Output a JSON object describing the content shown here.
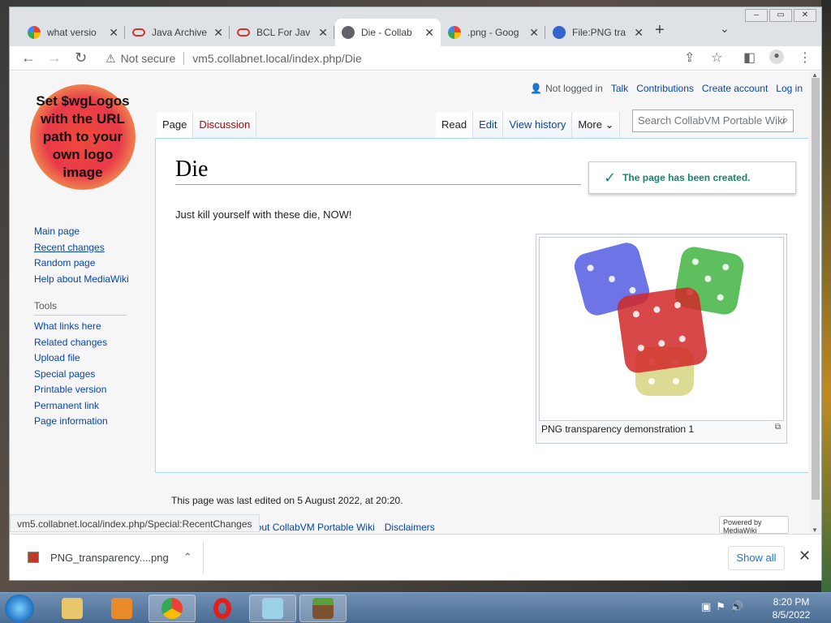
{
  "browser": {
    "tabs": [
      {
        "title": "what versio",
        "icon": "google-icon"
      },
      {
        "title": "Java Archive",
        "icon": "oracle-icon"
      },
      {
        "title": "BCL For Jav",
        "icon": "oracle-icon"
      },
      {
        "title": "Die - Collab",
        "icon": "globe-icon",
        "active": true
      },
      {
        "title": ".png - Goog",
        "icon": "google-icon"
      },
      {
        "title": "File:PNG tra",
        "icon": "wiki-icon"
      }
    ],
    "not_secure": "Not secure",
    "url": "vm5.collabnet.local/index.php/Die",
    "status_url": "vm5.collabnet.local/index.php/Special:RecentChanges"
  },
  "wiki": {
    "logo_text": "Set $wgLogos with the URL path to your own logo image",
    "personal": {
      "not_logged_in": "Not logged in",
      "talk": "Talk",
      "contributions": "Contributions",
      "create_account": "Create account",
      "log_in": "Log in"
    },
    "nav": [
      "Main page",
      "Recent changes",
      "Random page",
      "Help about MediaWiki"
    ],
    "tools_header": "Tools",
    "tools": [
      "What links here",
      "Related changes",
      "Upload file",
      "Special pages",
      "Printable version",
      "Permanent link",
      "Page information"
    ],
    "namespaces": {
      "page": "Page",
      "discussion": "Discussion"
    },
    "views": {
      "read": "Read",
      "edit": "Edit",
      "history": "View history",
      "more": "More"
    },
    "search_placeholder": "Search CollabVM Portable Wiki",
    "title": "Die",
    "notification": "The page has been created.",
    "body": "Just kill yourself with these die, NOW!",
    "image_caption": "PNG transparency demonstration 1",
    "last_edited": "This page was last edited on 5 August 2022, at 20:20.",
    "footer_links": [
      "About CollabVM Portable Wiki",
      "Disclaimers"
    ],
    "powered_by": "Powered by MediaWiki"
  },
  "downloads": {
    "file": "PNG_transparency....png",
    "show_all": "Show all"
  },
  "taskbar": {
    "time": "8:20 PM",
    "date": "8/5/2022"
  }
}
